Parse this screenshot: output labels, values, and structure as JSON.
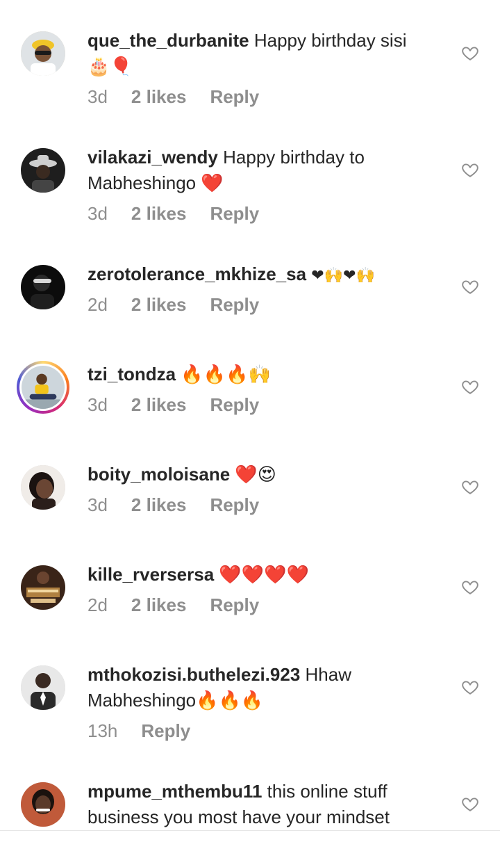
{
  "comments": [
    {
      "username": "que_the_durbanite",
      "text": "Happy birthday sisi🎂🎈",
      "time": "3d",
      "likes": "2 likes",
      "reply": "Reply",
      "avatar_color": "#d9c8a8"
    },
    {
      "username": "vilakazi_wendy",
      "text": "Happy birthday to Mabheshingo ❤️",
      "time": "3d",
      "likes": "2 likes",
      "reply": "Reply",
      "avatar_color": "#2a2a2a"
    },
    {
      "username": "zerotolerance_mkhize_sa",
      "text": "❤🙌❤🙌",
      "time": "2d",
      "likes": "2 likes",
      "reply": "Reply",
      "avatar_color": "#111111"
    },
    {
      "username": "tzi_tondza",
      "text": "🔥🔥🔥🙌",
      "time": "3d",
      "likes": "2 likes",
      "reply": "Reply",
      "avatar_color": "#d9b56a"
    },
    {
      "username": "boity_moloisane",
      "text": "❤️😍",
      "time": "3d",
      "likes": "2 likes",
      "reply": "Reply",
      "avatar_color": "#e8e2dc"
    },
    {
      "username": "kille_rversersa",
      "text": "❤️❤️❤️❤️",
      "time": "2d",
      "likes": "2 likes",
      "reply": "Reply",
      "avatar_color": "#5a3a2a"
    },
    {
      "username": "mthokozisi.buthelezi.923",
      "text": "Hhaw Mabheshingo🔥🔥🔥",
      "time": "13h",
      "reply": "Reply",
      "avatar_color": "#9a9a9a"
    },
    {
      "username": "mpume_mthembu11",
      "text": "this online stuff business you most have your mindset",
      "avatar_color": "#3a2a24"
    }
  ],
  "colors": {
    "meta_text": "#8e8e8e",
    "heart_outline": "#8e8e8e",
    "primary_text": "#262626"
  },
  "icons": {
    "like": "heart-outline-icon"
  }
}
